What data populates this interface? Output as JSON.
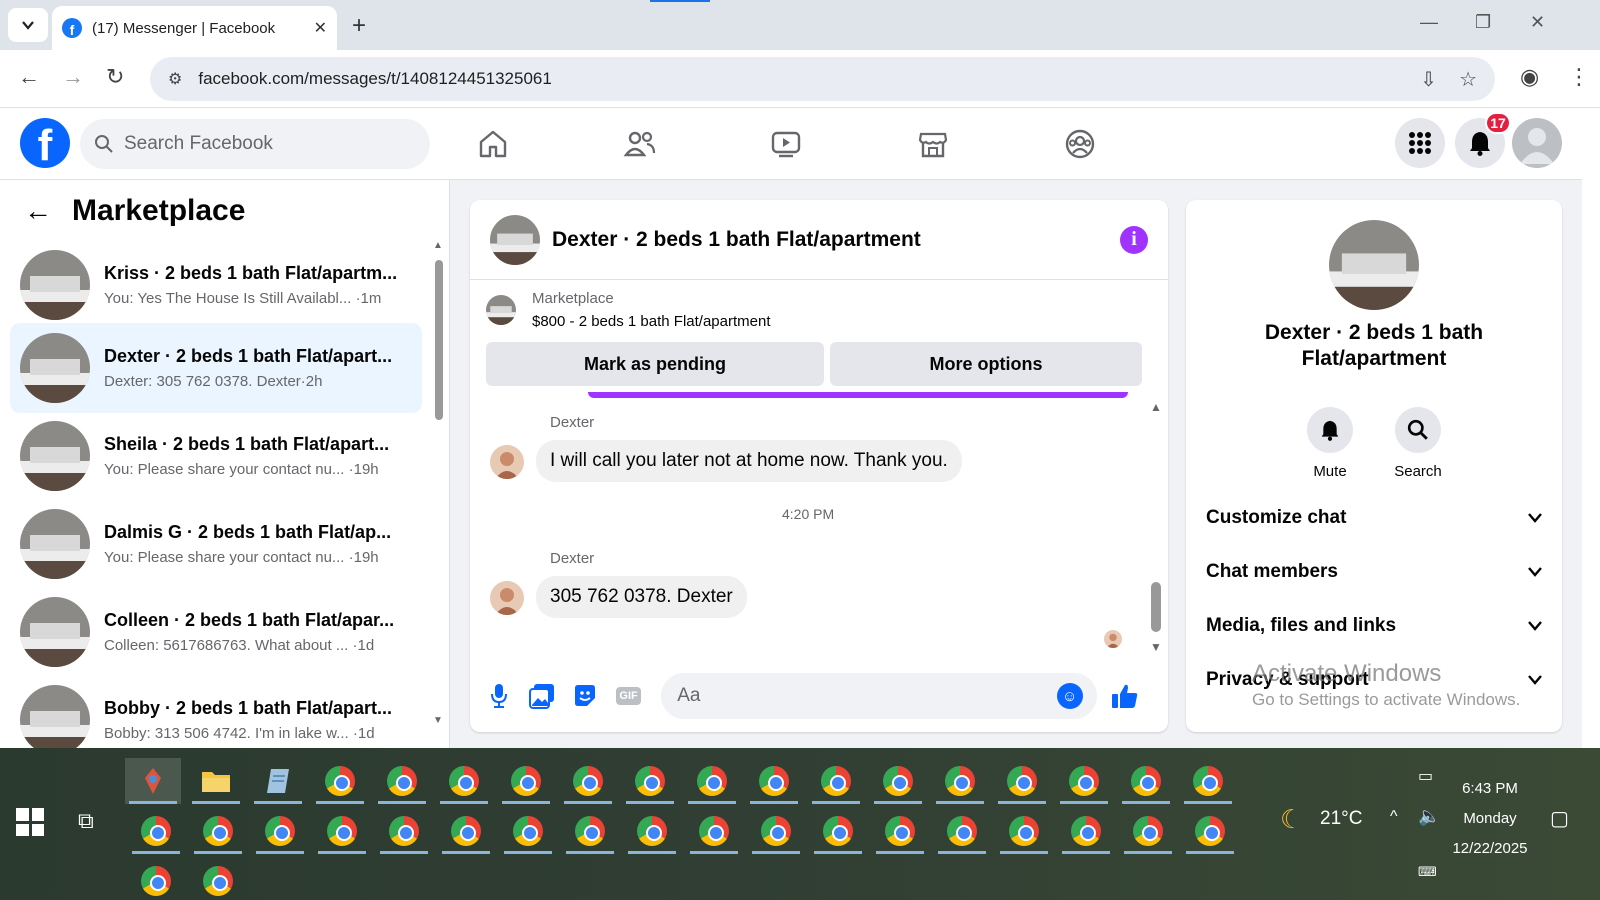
{
  "browser": {
    "tab_title": "(17) Messenger | Facebook",
    "url": "facebook.com/messages/t/1408124451325061"
  },
  "fb_nav": {
    "search_placeholder": "Search Facebook",
    "notification_count": "17"
  },
  "left_panel": {
    "title": "Marketplace",
    "conversations": [
      {
        "title": "Kriss · 2 beds 1 bath Flat/apartm...",
        "preview": "You: Yes The House Is Still Availabl...",
        "time": "·1m"
      },
      {
        "title": "Dexter · 2 beds 1 bath Flat/apart...",
        "preview": "Dexter: 305 762 0378. Dexter",
        "time": "·2h"
      },
      {
        "title": "Sheila · 2 beds 1 bath Flat/apart...",
        "preview": "You: Please share your contact nu...",
        "time": "·19h"
      },
      {
        "title": "Dalmis G · 2 beds 1 bath Flat/ap...",
        "preview": "You: Please share your contact nu...",
        "time": "·19h"
      },
      {
        "title": "Colleen · 2 beds 1 bath Flat/apar...",
        "preview": "Colleen: 5617686763. What about ...",
        "time": "·1d"
      },
      {
        "title": "Bobby · 2 beds 1 bath Flat/apart...",
        "preview": "Bobby: 313 506 4742. I'm in lake w...",
        "time": "·1d"
      }
    ]
  },
  "chat": {
    "header_title": "Dexter · 2 beds 1 bath Flat/apartment",
    "marketplace_label": "Marketplace",
    "listing": "$800 - 2 beds 1 bath Flat/apartment",
    "mark_pending": "Mark as pending",
    "more_options": "More options",
    "messages": [
      {
        "sender": "Dexter",
        "text": "I will call you later not at home now. Thank you."
      },
      {
        "sender": "Dexter",
        "text": "305 762 0378. Dexter"
      }
    ],
    "timestamp": "4:20 PM",
    "composer_placeholder": "Aa"
  },
  "right_panel": {
    "name": "Dexter · 2 beds 1 bath Flat/apartment",
    "mute_label": "Mute",
    "search_label": "Search",
    "sections": [
      "Customize chat",
      "Chat members",
      "Media, files and links",
      "Privacy & support"
    ]
  },
  "watermark": {
    "line1": "Activate Windows",
    "line2": "Go to Settings to activate Windows."
  },
  "taskbar": {
    "temperature": "21°C",
    "time": "6:43 PM",
    "day": "Monday",
    "date": "12/22/2025"
  },
  "colors": {
    "fb_blue": "#0866ff",
    "messenger_purple": "#a033ff",
    "active_conversation": "#ebf5ff",
    "notification_red": "#e41e3f"
  }
}
